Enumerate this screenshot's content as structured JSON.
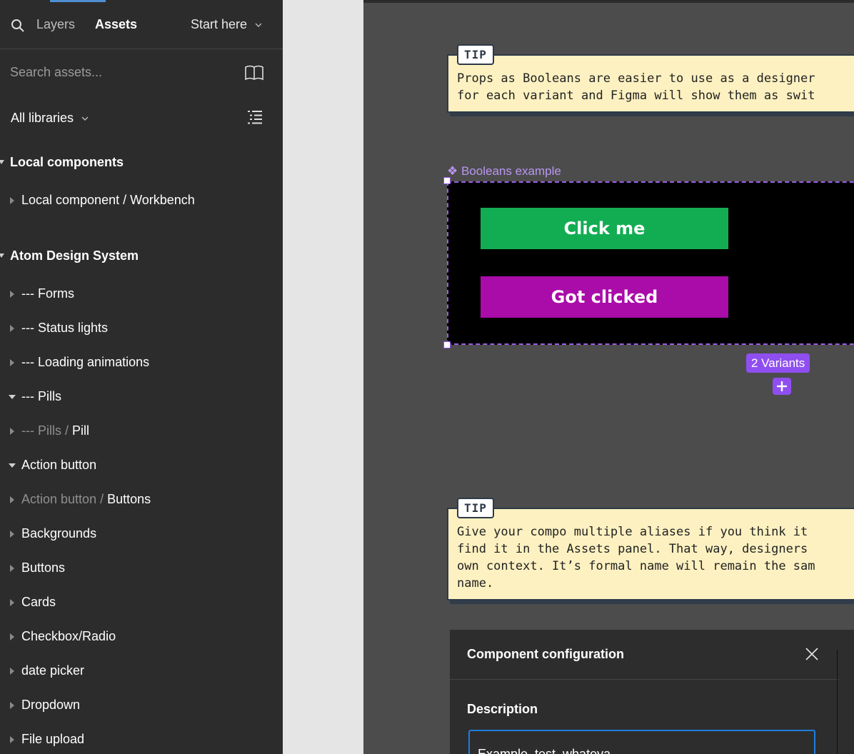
{
  "sidebar": {
    "tabs": {
      "layers": "Layers",
      "assets": "Assets"
    },
    "page_selector": "Start here",
    "search_placeholder": "Search assets...",
    "library_filter": "All libraries",
    "sections": [
      {
        "title": "Local components",
        "items": [
          {
            "label": "Local component / Workbench"
          }
        ]
      },
      {
        "title": "Atom Design System",
        "items": [
          {
            "label": "--- Forms"
          },
          {
            "label": "--- Status lights"
          },
          {
            "label": "--- Loading animations"
          },
          {
            "label": "--- Pills"
          },
          {
            "parent": "--- Pills / ",
            "label": "Pill"
          },
          {
            "label": "Action button"
          },
          {
            "parent": "Action button / ",
            "label": "Buttons"
          },
          {
            "label": "Backgrounds"
          },
          {
            "label": "Buttons"
          },
          {
            "label": "Cards"
          },
          {
            "label": "Checkbox/Radio"
          },
          {
            "label": "date picker"
          },
          {
            "label": "Dropdown"
          },
          {
            "label": "File upload"
          }
        ]
      }
    ]
  },
  "canvas": {
    "tip1": {
      "label": "TIP",
      "line1": "Props as Booleans are easier to use as a designer",
      "line2": "for each variant and Figma will show them as swit"
    },
    "frame_label": "❖ Booleans example",
    "button_click": "Click me",
    "button_clicked": "Got clicked",
    "variants_badge": "2 Variants",
    "tip2": {
      "label": "TIP",
      "line1": "Give your compo multiple aliases if you think it",
      "line2": "find it in the Assets panel. That way, designers",
      "line3": "own context. It’s formal name will remain the sam",
      "line4": "name."
    }
  },
  "config_panel": {
    "title": "Component configuration",
    "description_label": "Description",
    "description_value": "Example, test, whateva"
  },
  "colors": {
    "accent": "#8f4ff0",
    "green_button": "#12ad52",
    "purple_button": "#a90ca9",
    "tip_background": "#fdf1c1",
    "focus_blue": "#1e7ee0"
  }
}
